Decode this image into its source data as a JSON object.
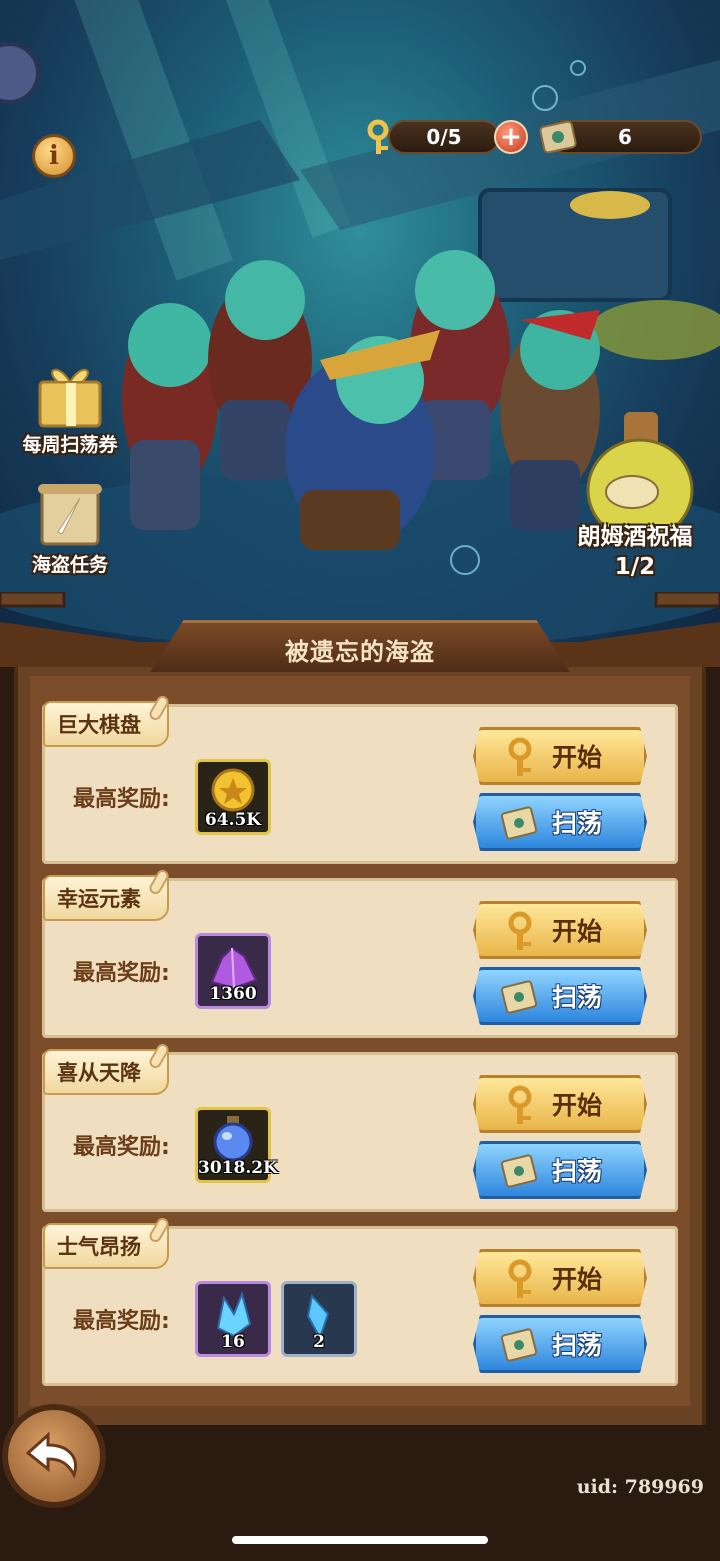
{
  "hud": {
    "keys_count": "0/5",
    "scroll_count": "6"
  },
  "side": {
    "weekly_ticket_label": "每周扫荡券",
    "pirate_task_label": "海盗任务",
    "rum_blessing_label": "朗姆酒祝福",
    "rum_blessing_count": "1/2"
  },
  "panel": {
    "title": "被遗忘的海盗"
  },
  "stages": [
    {
      "name": "巨大棋盘",
      "reward_label": "最高奖励:",
      "rewards": [
        {
          "icon": "gold-coin-icon",
          "qty": "64.5K"
        }
      ],
      "start_label": "开始",
      "sweep_label": "扫荡"
    },
    {
      "name": "幸运元素",
      "reward_label": "最高奖励:",
      "rewards": [
        {
          "icon": "purple-crystal-icon",
          "qty": "1360"
        }
      ],
      "start_label": "开始",
      "sweep_label": "扫荡"
    },
    {
      "name": "喜从天降",
      "reward_label": "最高奖励:",
      "rewards": [
        {
          "icon": "blue-potion-icon",
          "qty": "3018.2K"
        }
      ],
      "start_label": "开始",
      "sweep_label": "扫荡"
    },
    {
      "name": "士气昂扬",
      "reward_label": "最高奖励:",
      "rewards": [
        {
          "icon": "blue-crystal-cluster-icon",
          "qty": "16"
        },
        {
          "icon": "blue-crystal-shard-icon",
          "qty": "2"
        }
      ],
      "start_label": "开始",
      "sweep_label": "扫荡"
    }
  ],
  "footer": {
    "uid": "uid: 789969"
  }
}
